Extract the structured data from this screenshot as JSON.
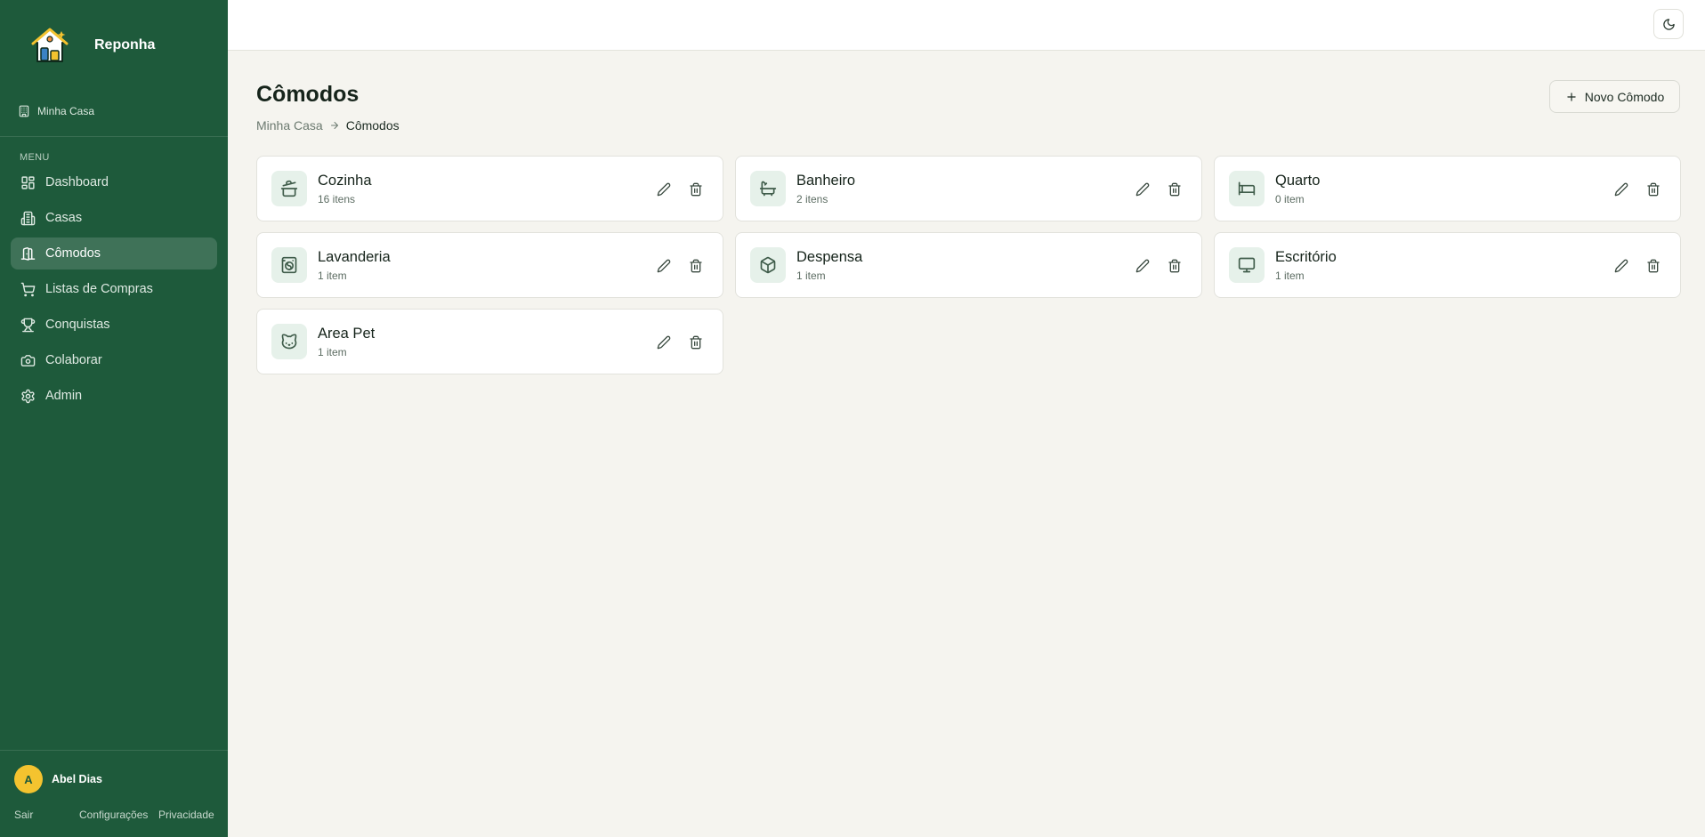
{
  "app": {
    "name": "Reponha"
  },
  "sidebar": {
    "house": "Minha Casa",
    "menu_label": "MENU",
    "items": [
      {
        "label": "Dashboard",
        "icon": "dashboard-icon",
        "active": false
      },
      {
        "label": "Casas",
        "icon": "building-icon",
        "active": false
      },
      {
        "label": "Cômodos",
        "icon": "door-icon",
        "active": true
      },
      {
        "label": "Listas de Compras",
        "icon": "cart-icon",
        "active": false
      },
      {
        "label": "Conquistas",
        "icon": "trophy-icon",
        "active": false
      },
      {
        "label": "Colaborar",
        "icon": "camera-icon",
        "active": false
      },
      {
        "label": "Admin",
        "icon": "gear-icon",
        "active": false
      }
    ],
    "user": {
      "initial": "A",
      "name": "Abel Dias"
    },
    "footer": {
      "logout": "Sair",
      "settings": "Configurações",
      "privacy": "Privacidade"
    }
  },
  "header": {
    "theme_toggle_icon": "moon-icon"
  },
  "page": {
    "title": "Cômodos",
    "breadcrumb": {
      "parent": "Minha Casa",
      "current": "Cômodos"
    },
    "new_button": "Novo Cômodo"
  },
  "rooms": [
    {
      "name": "Cozinha",
      "count": "16 itens",
      "icon": "pot-icon"
    },
    {
      "name": "Banheiro",
      "count": "2 itens",
      "icon": "bath-icon"
    },
    {
      "name": "Quarto",
      "count": "0 item",
      "icon": "bed-icon"
    },
    {
      "name": "Lavanderia",
      "count": "1 item",
      "icon": "washing-machine-icon"
    },
    {
      "name": "Despensa",
      "count": "1 item",
      "icon": "box-icon"
    },
    {
      "name": "Escritório",
      "count": "1 item",
      "icon": "monitor-icon"
    },
    {
      "name": "Area Pet",
      "count": "1 item",
      "icon": "cat-icon"
    }
  ],
  "colors": {
    "sidebar": "#1e5a3b",
    "accent": "#f4c32f",
    "background": "#f5f4ef"
  }
}
